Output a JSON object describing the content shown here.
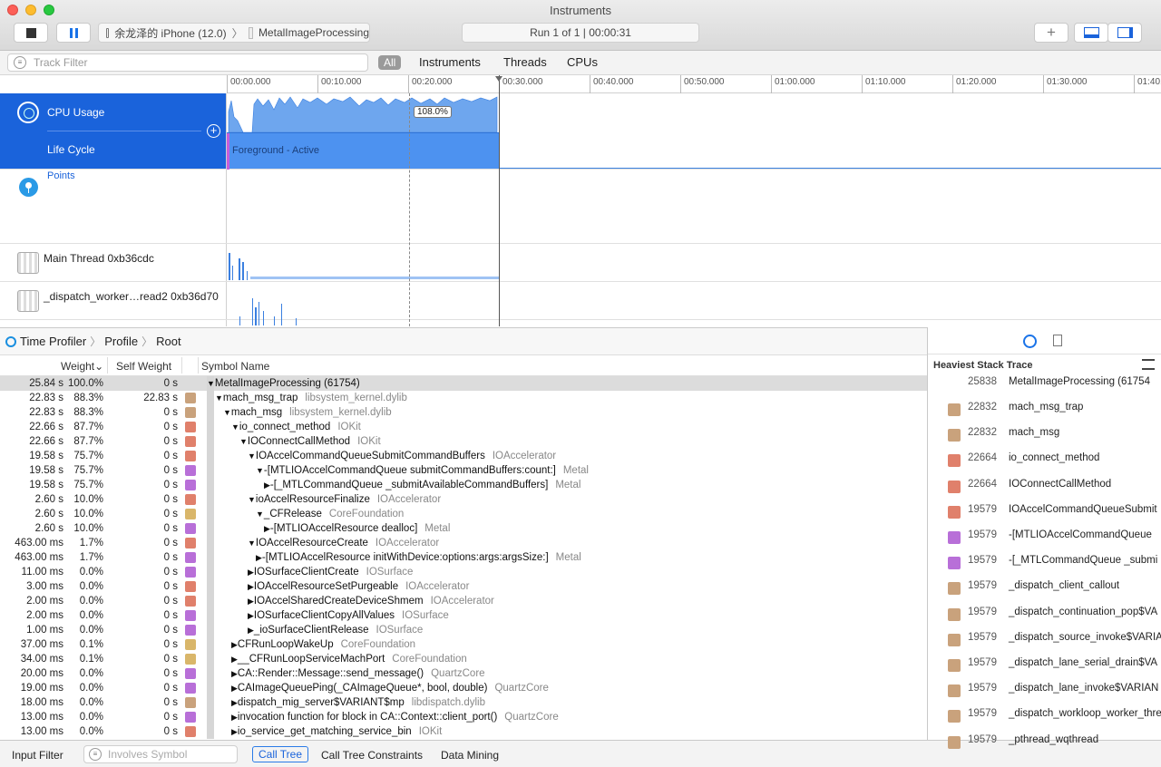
{
  "window": {
    "title": "Instruments"
  },
  "toolbar": {
    "device": "余龙泽的 iPhone (12.0)",
    "app": "MetalImageProcessing",
    "run_status": "Run 1 of 1  |  00:00:31",
    "add_label": "+"
  },
  "filter": {
    "placeholder": "Track Filter",
    "segments": [
      "All",
      "Instruments",
      "Threads",
      "CPUs"
    ]
  },
  "ruler": {
    "ticks": [
      "00:00.000",
      "00:10.000",
      "00:20.000",
      "00:30.000",
      "00:40.000",
      "00:50.000",
      "01:00.000",
      "01:10.000",
      "01:20.000",
      "01:30.000",
      "01:40.0"
    ]
  },
  "tracks": {
    "cpu_usage": "CPU Usage",
    "life_cycle": "Life Cycle",
    "life_state": "Foreground - Active",
    "cpu_peak": "108.0%",
    "points": "Points",
    "main_thread": "Main Thread  0xb36cdc",
    "worker_thread": "_dispatch_worker…read2  0xb36d70"
  },
  "breadcrumb": [
    "Time Profiler",
    "Profile",
    "Root"
  ],
  "columns": {
    "weight": "Weight",
    "self_weight": "Self Weight",
    "symbol": "Symbol Name"
  },
  "rows": [
    {
      "w": "25.84 s",
      "p": "100.0%",
      "sw": "0 s",
      "icon": "none",
      "indent": 0,
      "arrow": "▼",
      "sym": "MetalImageProcessing (61754)",
      "lib": "",
      "selected": true
    },
    {
      "w": "22.83 s",
      "p": "88.3%",
      "sw": "22.83 s",
      "icon": "sys",
      "indent": 1,
      "arrow": "▼",
      "sym": "mach_msg_trap",
      "lib": "libsystem_kernel.dylib"
    },
    {
      "w": "22.83 s",
      "p": "88.3%",
      "sw": "0 s",
      "icon": "sys",
      "indent": 2,
      "arrow": "▼",
      "sym": "mach_msg",
      "lib": "libsystem_kernel.dylib"
    },
    {
      "w": "22.66 s",
      "p": "87.7%",
      "sw": "0 s",
      "icon": "io",
      "indent": 3,
      "arrow": "▼",
      "sym": "io_connect_method",
      "lib": "IOKit"
    },
    {
      "w": "22.66 s",
      "p": "87.7%",
      "sw": "0 s",
      "icon": "io",
      "indent": 4,
      "arrow": "▼",
      "sym": "IOConnectCallMethod",
      "lib": "IOKit"
    },
    {
      "w": "19.58 s",
      "p": "75.7%",
      "sw": "0 s",
      "icon": "io",
      "indent": 5,
      "arrow": "▼",
      "sym": "IOAccelCommandQueueSubmitCommandBuffers",
      "lib": "IOAccelerator"
    },
    {
      "w": "19.58 s",
      "p": "75.7%",
      "sw": "0 s",
      "icon": "mtl",
      "indent": 6,
      "arrow": "▼",
      "sym": "-[MTLIOAccelCommandQueue submitCommandBuffers:count:]",
      "lib": "Metal"
    },
    {
      "w": "19.58 s",
      "p": "75.7%",
      "sw": "0 s",
      "icon": "mtl",
      "indent": 7,
      "arrow": "▶",
      "sym": "-[_MTLCommandQueue _submitAvailableCommandBuffers]",
      "lib": "Metal"
    },
    {
      "w": "2.60 s",
      "p": "10.0%",
      "sw": "0 s",
      "icon": "io",
      "indent": 5,
      "arrow": "▼",
      "sym": "ioAccelResourceFinalize",
      "lib": "IOAccelerator"
    },
    {
      "w": "2.60 s",
      "p": "10.0%",
      "sw": "0 s",
      "icon": "cf",
      "indent": 6,
      "arrow": "▼",
      "sym": "_CFRelease",
      "lib": "CoreFoundation"
    },
    {
      "w": "2.60 s",
      "p": "10.0%",
      "sw": "0 s",
      "icon": "mtl",
      "indent": 7,
      "arrow": "▶",
      "sym": "-[MTLIOAccelResource dealloc]",
      "lib": "Metal"
    },
    {
      "w": "463.00 ms",
      "p": "1.7%",
      "sw": "0 s",
      "icon": "io",
      "indent": 5,
      "arrow": "▼",
      "sym": "IOAccelResourceCreate",
      "lib": "IOAccelerator"
    },
    {
      "w": "463.00 ms",
      "p": "1.7%",
      "sw": "0 s",
      "icon": "mtl",
      "indent": 6,
      "arrow": "▶",
      "sym": "-[MTLIOAccelResource initWithDevice:options:args:argsSize:]",
      "lib": "Metal"
    },
    {
      "w": "11.00 ms",
      "p": "0.0%",
      "sw": "0 s",
      "icon": "mtl",
      "indent": 5,
      "arrow": "▶",
      "sym": "IOSurfaceClientCreate",
      "lib": "IOSurface"
    },
    {
      "w": "3.00 ms",
      "p": "0.0%",
      "sw": "0 s",
      "icon": "io",
      "indent": 5,
      "arrow": "▶",
      "sym": "IOAccelResourceSetPurgeable",
      "lib": "IOAccelerator"
    },
    {
      "w": "2.00 ms",
      "p": "0.0%",
      "sw": "0 s",
      "icon": "io",
      "indent": 5,
      "arrow": "▶",
      "sym": "IOAccelSharedCreateDeviceShmem",
      "lib": "IOAccelerator"
    },
    {
      "w": "2.00 ms",
      "p": "0.0%",
      "sw": "0 s",
      "icon": "mtl",
      "indent": 5,
      "arrow": "▶",
      "sym": "IOSurfaceClientCopyAllValues",
      "lib": "IOSurface"
    },
    {
      "w": "1.00 ms",
      "p": "0.0%",
      "sw": "0 s",
      "icon": "mtl",
      "indent": 5,
      "arrow": "▶",
      "sym": "_ioSurfaceClientRelease",
      "lib": "IOSurface"
    },
    {
      "w": "37.00 ms",
      "p": "0.1%",
      "sw": "0 s",
      "icon": "cf",
      "indent": 3,
      "arrow": "▶",
      "sym": "CFRunLoopWakeUp",
      "lib": "CoreFoundation"
    },
    {
      "w": "34.00 ms",
      "p": "0.1%",
      "sw": "0 s",
      "icon": "cf",
      "indent": 3,
      "arrow": "▶",
      "sym": "__CFRunLoopServiceMachPort",
      "lib": "CoreFoundation"
    },
    {
      "w": "20.00 ms",
      "p": "0.0%",
      "sw": "0 s",
      "icon": "mtl",
      "indent": 3,
      "arrow": "▶",
      "sym": "CA::Render::Message::send_message()",
      "lib": "QuartzCore"
    },
    {
      "w": "19.00 ms",
      "p": "0.0%",
      "sw": "0 s",
      "icon": "mtl",
      "indent": 3,
      "arrow": "▶",
      "sym": "CAImageQueuePing(_CAImageQueue*, bool, double)",
      "lib": "QuartzCore"
    },
    {
      "w": "18.00 ms",
      "p": "0.0%",
      "sw": "0 s",
      "icon": "sys",
      "indent": 3,
      "arrow": "▶",
      "sym": "dispatch_mig_server$VARIANT$mp",
      "lib": "libdispatch.dylib"
    },
    {
      "w": "13.00 ms",
      "p": "0.0%",
      "sw": "0 s",
      "icon": "mtl",
      "indent": 3,
      "arrow": "▶",
      "sym": "invocation function for block in CA::Context::client_port()",
      "lib": "QuartzCore"
    },
    {
      "w": "13.00 ms",
      "p": "0.0%",
      "sw": "0 s",
      "icon": "io",
      "indent": 3,
      "arrow": "▶",
      "sym": "io_service_get_matching_service_bin",
      "lib": "IOKit"
    }
  ],
  "bottom": {
    "input_filter": "Input Filter",
    "involves_placeholder": "Involves Symbol",
    "tabs": [
      "Call Tree",
      "Call Tree Constraints",
      "Data Mining"
    ]
  },
  "inspector": {
    "title": "Heaviest Stack Trace",
    "header_num": "25838",
    "header_name": "MetalImageProcessing (61754",
    "frames": [
      {
        "num": "22832",
        "name": "mach_msg_trap",
        "icon": "sys"
      },
      {
        "num": "22832",
        "name": "mach_msg",
        "icon": "sys"
      },
      {
        "num": "22664",
        "name": "io_connect_method",
        "icon": "io"
      },
      {
        "num": "22664",
        "name": "IOConnectCallMethod",
        "icon": "io"
      },
      {
        "num": "19579",
        "name": "IOAccelCommandQueueSubmit",
        "icon": "io"
      },
      {
        "num": "19579",
        "name": "-[MTLIOAccelCommandQueue",
        "icon": "mtl"
      },
      {
        "num": "19579",
        "name": "-[_MTLCommandQueue _submi",
        "icon": "mtl"
      },
      {
        "num": "19579",
        "name": "_dispatch_client_callout",
        "icon": "sys"
      },
      {
        "num": "19579",
        "name": "_dispatch_continuation_pop$VA",
        "icon": "sys"
      },
      {
        "num": "19579",
        "name": "_dispatch_source_invoke$VARIA",
        "icon": "sys"
      },
      {
        "num": "19579",
        "name": "_dispatch_lane_serial_drain$VA",
        "icon": "sys"
      },
      {
        "num": "19579",
        "name": "_dispatch_lane_invoke$VARIAN",
        "icon": "sys"
      },
      {
        "num": "19579",
        "name": "_dispatch_workloop_worker_thre",
        "icon": "sys"
      },
      {
        "num": "19579",
        "name": "_pthread_wqthread",
        "icon": "sys"
      }
    ]
  }
}
